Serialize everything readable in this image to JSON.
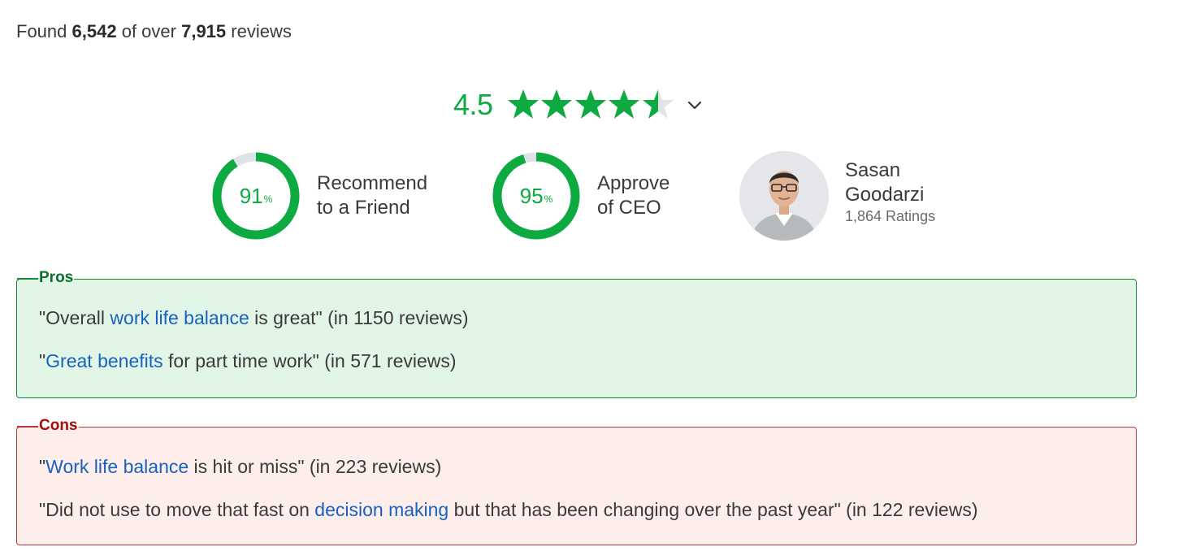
{
  "summary": {
    "prefix": "Found",
    "found_count": "6,542",
    "middle": "of over",
    "total_count": "7,915",
    "suffix": "reviews"
  },
  "rating": {
    "value": "4.5",
    "stars": 4.5,
    "max_stars": 5,
    "color": "#0caa41",
    "dropdown_icon": "chevron-down-icon"
  },
  "metrics": {
    "recommend": {
      "percent": 91,
      "number": "91",
      "unit": "%",
      "line1": "Recommend",
      "line2": "to a Friend"
    },
    "ceo_approval": {
      "percent": 95,
      "number": "95",
      "unit": "%",
      "line1": "Approve",
      "line2": "of CEO"
    }
  },
  "ceo": {
    "first_name": "Sasan",
    "last_name": "Goodarzi",
    "ratings": "1,864 Ratings"
  },
  "pros": {
    "title": "Pros",
    "items": [
      {
        "before": "\"Overall ",
        "link": "work life balance",
        "after": " is great\" (in 1150 reviews)"
      },
      {
        "before": "\"",
        "link": "Great benefits",
        "after": " for part time work\" (in 571 reviews)"
      }
    ]
  },
  "cons": {
    "title": "Cons",
    "items": [
      {
        "before": "\"",
        "link": "Work life balance",
        "after": " is hit or miss\" (in 223 reviews)"
      },
      {
        "before": "\"Did not use to move that fast on ",
        "link": "decision making",
        "after": " but that has been changing over the past year\" (in 122 reviews)"
      }
    ]
  },
  "colors": {
    "accent_green": "#0caa41",
    "link_blue": "#1861bf",
    "pros_bg": "#e1f6e6",
    "cons_bg": "#fdeeec"
  }
}
